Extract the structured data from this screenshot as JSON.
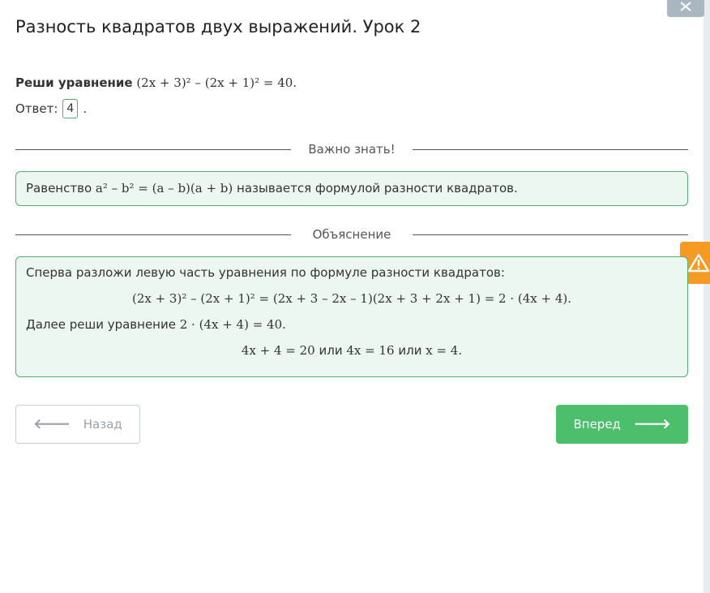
{
  "title": "Разность квадратов двух выражений. Урок 2",
  "problem": {
    "label": "Реши уравнение",
    "equation": "(2x + 3)² – (2x + 1)² = 40."
  },
  "answer": {
    "label": "Ответ:",
    "value": "4",
    "suffix": "."
  },
  "important": {
    "heading": "Важно знать!",
    "text_before": "Равенство",
    "formula": "a² – b² = (a – b)(a + b)",
    "text_after": "называется формулой разности квадратов."
  },
  "explanation": {
    "heading": "Объяснение",
    "line1": "Сперва разложи левую часть уравнения по формуле разности квадратов:",
    "formula1": "(2x + 3)² – (2x + 1)² = (2x + 3 – 2x – 1)(2x + 3 + 2x + 1) = 2 · (4x + 4).",
    "line2_text": "Далее реши уравнение",
    "line2_formula": "2 · (4x + 4) = 40.",
    "solution_part1": "4x + 4 = 20",
    "or1": "или",
    "solution_part2": "4x = 16",
    "or2": "или",
    "solution_part3": "x = 4."
  },
  "buttons": {
    "back_label": "Назад",
    "next_label": "Вперед"
  },
  "icons": {
    "fullscreen": "expand-icon",
    "warning": "warning-icon",
    "back_arrow": "arrow-left-icon",
    "next_arrow": "arrow-right-icon"
  },
  "colors": {
    "accent_green": "#4cbe6c",
    "box_border": "#4fb072",
    "box_bg": "#ebf7f0",
    "warning_orange": "#f59a23"
  }
}
